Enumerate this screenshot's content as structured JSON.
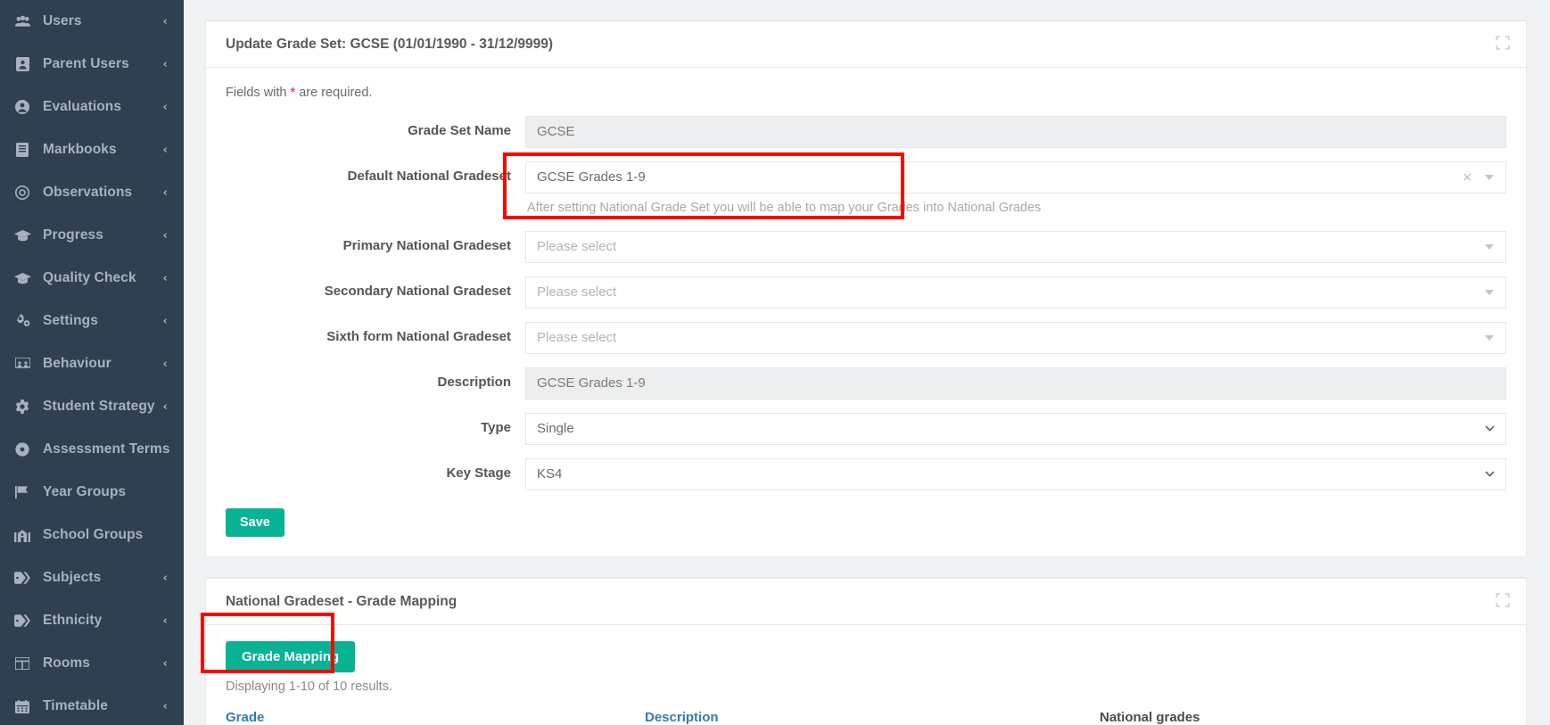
{
  "sidebar": {
    "items": [
      {
        "label": "Users",
        "icon": "users-icon",
        "caret": "‹",
        "has_caret": true
      },
      {
        "label": "Parent Users",
        "icon": "id-card-icon",
        "caret": "‹",
        "has_caret": true
      },
      {
        "label": "Evaluations",
        "icon": "user-circle-icon",
        "caret": "‹",
        "has_caret": true
      },
      {
        "label": "Markbooks",
        "icon": "book-icon",
        "caret": "‹",
        "has_caret": true
      },
      {
        "label": "Observations",
        "icon": "target-icon",
        "caret": "‹",
        "has_caret": true
      },
      {
        "label": "Progress",
        "icon": "graduation-cap-icon",
        "caret": "‹",
        "has_caret": true
      },
      {
        "label": "Quality Check",
        "icon": "graduation-cap-icon",
        "caret": "‹",
        "has_caret": true
      },
      {
        "label": "Settings",
        "icon": "gears-icon",
        "caret": "‹",
        "has_caret": true
      },
      {
        "label": "Behaviour",
        "icon": "chalkboard-icon",
        "caret": "‹",
        "has_caret": true
      },
      {
        "label": "Student Strategy",
        "icon": "gear-icon",
        "caret": "‹",
        "has_caret": true
      },
      {
        "label": "Assessment Terms",
        "icon": "dot-circle-icon",
        "caret": "",
        "has_caret": false
      },
      {
        "label": "Year Groups",
        "icon": "flag-icon",
        "caret": "",
        "has_caret": false
      },
      {
        "label": "School Groups",
        "icon": "school-icon",
        "caret": "",
        "has_caret": false
      },
      {
        "label": "Subjects",
        "icon": "tag-icon",
        "caret": "‹",
        "has_caret": true
      },
      {
        "label": "Ethnicity",
        "icon": "tag-icon",
        "caret": "‹",
        "has_caret": true
      },
      {
        "label": "Rooms",
        "icon": "table-icon",
        "caret": "‹",
        "has_caret": true
      },
      {
        "label": "Timetable",
        "icon": "calendar-icon",
        "caret": "‹",
        "has_caret": true
      }
    ]
  },
  "grade_set_panel": {
    "title": "Update Grade Set: GCSE (01/01/1990 - 31/12/9999)",
    "expand_icon": "expand-icon",
    "required_note_prefix": "Fields with ",
    "required_note_star": "*",
    "required_note_suffix": " are required.",
    "fields": {
      "grade_set_name": {
        "label": "Grade Set Name",
        "value": "GCSE",
        "disabled": true
      },
      "default_national": {
        "label": "Default National Gradeset",
        "value": "GCSE Grades 1-9",
        "clear": "×",
        "help": "After setting National Grade Set you will be able to map your Grades into National Grades"
      },
      "primary_national": {
        "label": "Primary National Gradeset",
        "placeholder": "Please select"
      },
      "secondary_national": {
        "label": "Secondary National Gradeset",
        "placeholder": "Please select"
      },
      "sixthform_national": {
        "label": "Sixth form National Gradeset",
        "placeholder": "Please select"
      },
      "description": {
        "label": "Description",
        "value": "GCSE Grades 1-9",
        "disabled": true
      },
      "type": {
        "label": "Type",
        "value": "Single",
        "options": [
          "Single"
        ]
      },
      "key_stage": {
        "label": "Key Stage",
        "value": "KS4",
        "options": [
          "KS4"
        ]
      }
    },
    "save_label": "Save"
  },
  "mapping_panel": {
    "title": "National Gradeset - Grade Mapping",
    "expand_icon": "expand-icon",
    "grade_mapping_label": "Grade Mapping",
    "results_text": "Displaying 1-10 of 10 results.",
    "columns": [
      {
        "label": "Grade",
        "style": "link"
      },
      {
        "label": "Description",
        "style": "link"
      },
      {
        "label": "National grades",
        "style": "plain"
      }
    ]
  },
  "annotations": {
    "highlight_color": "#ff0000",
    "boxes": [
      {
        "name": "default-national-gradeset-highlight"
      },
      {
        "name": "grade-mapping-button-highlight"
      }
    ]
  },
  "theme": {
    "sidebar_bg": "#2f4050",
    "sidebar_text": "#a7b1c2",
    "accent_green": "#08b394",
    "link_blue": "#337ab7",
    "required_red": "#ed5565"
  }
}
